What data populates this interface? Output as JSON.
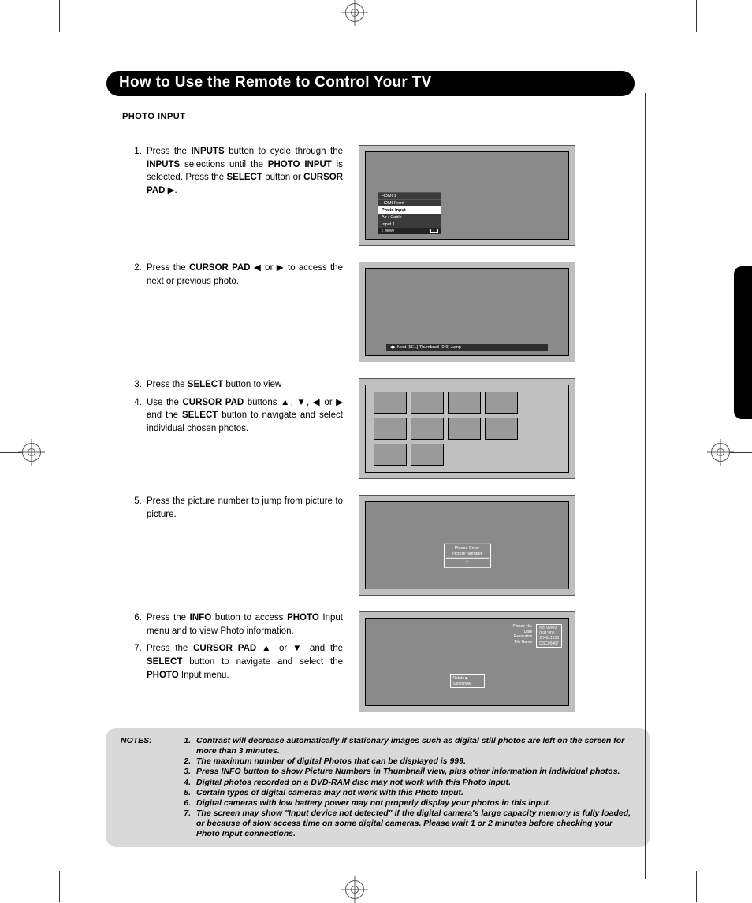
{
  "title": "How to Use the Remote to Control Your TV",
  "section_heading": "PHOTO INPUT",
  "steps": {
    "s1": {
      "pre1": "Press the ",
      "bold1": "INPUTS",
      "mid1": " button to cycle through the ",
      "bold2": "INPUTS",
      "mid2": " selections until the ",
      "bold3": "PHOTO  INPUT",
      "mid3": " is selected.  Press the ",
      "bold4": "SELECT",
      "mid4": " button or ",
      "bold5": "CURSOR PAD",
      "end": "."
    },
    "s2": {
      "pre": "Press the ",
      "bold": "CURSOR PAD",
      "mid": " ◀ or ▶ to access the next or previous photo."
    },
    "s3": {
      "pre": "Press the ",
      "bold": "SELECT",
      "end": " button to view"
    },
    "s4": {
      "pre": "Use the ",
      "bold1": "CURSOR PAD",
      "mid1": " buttons ▲, ▼, ◀ or ▶ and the ",
      "bold2": "SELECT",
      "end": " button to navigate and select individual chosen photos."
    },
    "s5": "Press the picture number to jump from picture to picture.",
    "s6": {
      "pre": "Press the ",
      "bold1": "INFO",
      "mid": " button to access ",
      "bold2": "PHOTO",
      "end": " Input menu and to view Photo information."
    },
    "s7": {
      "pre": "Press the ",
      "bold1": "CURSOR PAD",
      "mid": " ▲ or ▼ and the ",
      "bold2": "SELECT",
      "mid2": " button to navigate and select the ",
      "bold3": "PHOTO",
      "end": " Input menu."
    }
  },
  "screen1": {
    "items": [
      "HDMI 1",
      "HDMI-Front",
      "Photo Input",
      "Air / Cable",
      "Input 1"
    ],
    "selected": "Photo Input",
    "foot_left": "↕ Move"
  },
  "screen2": {
    "bar": "◀▶ Next       [SEL]  Thumbnail     [0-9] Jump"
  },
  "screen4": {
    "line1": "Please Enter",
    "line2": "Picture Number",
    "val": "--"
  },
  "screen5": {
    "labels": [
      "Picture No.",
      "Date",
      "Resolution",
      "File Name"
    ],
    "vals": [
      "No.  02/09",
      "06/13/05",
      "2048x1536",
      "DSC00467"
    ],
    "menu": [
      "Rotate        ▶",
      "Slideshow"
    ]
  },
  "notes": {
    "label": "NOTES:",
    "items": [
      "Contrast will decrease automatically if stationary images such as digital still photos are left on the screen for more than 3 minutes.",
      "The maximum number of digital Photos that can be displayed is 999.",
      "Press INFO button to show Picture Numbers in Thumbnail view, plus other information in individual photos.",
      "Digital photos recorded on a DVD-RAM disc may not work with this Photo Input.",
      "Certain types of digital cameras may not work with this Photo Input.",
      "Digital cameras with low battery power may not properly display your photos in this input.",
      "The screen may show \"Input device not detected\" if the digital camera's large capacity memory is fully loaded, or because of slow access time on some digital cameras.  Please wait 1 or 2 minutes before checking your Photo Input connections."
    ]
  }
}
